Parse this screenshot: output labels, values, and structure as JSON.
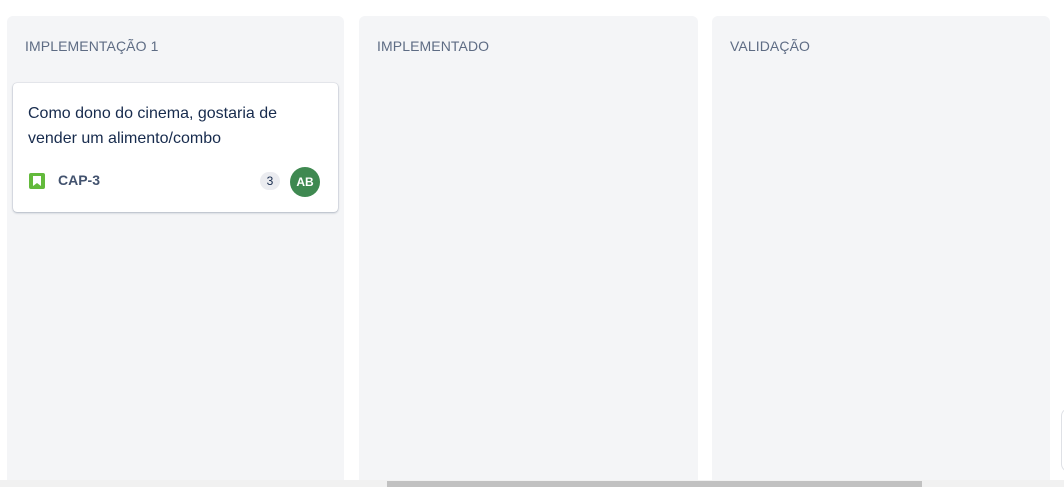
{
  "board": {
    "columns": [
      {
        "title": "IMPLEMENTAÇÃO 1",
        "cards": [
          {
            "summary": "Como dono do cinema, gostaria de vender um alimento/combo",
            "issue_type_icon": "story-bookmark-icon",
            "issue_key": "CAP-3",
            "estimate": "3",
            "assignee_initials": "AB"
          }
        ]
      },
      {
        "title": "IMPLEMENTADO",
        "cards": []
      },
      {
        "title": "VALIDAÇÃO",
        "cards": []
      }
    ]
  },
  "colors": {
    "column_background": "#f4f5f7",
    "story_icon": "#63ba3c",
    "avatar": "#3f8951",
    "column_title": "#5e6c84"
  }
}
